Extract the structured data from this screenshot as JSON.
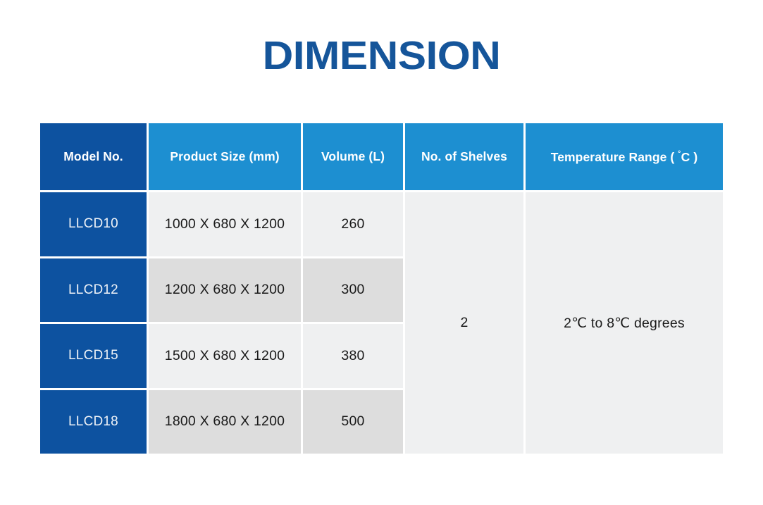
{
  "title": "DIMENSION",
  "colors": {
    "title_blue": "#15559a",
    "header_dark_blue": "#0d52a0",
    "header_light_blue": "#1d8fd1",
    "row_light": "#eff0f1",
    "row_dark": "#dddddd",
    "page_background": "#ffffff",
    "header_text": "#ffffff",
    "model_text": "#eef2f7",
    "body_text": "#1a1a1a"
  },
  "table": {
    "headers": {
      "model": "Model No.",
      "size": "Product Size (mm)",
      "volume": "Volume (L)",
      "shelves": "No. of Shelves",
      "temperature_prefix": "Temperature Range ( ",
      "temperature_degree": "˚",
      "temperature_suffix": "C )",
      "temperature_full": "Temperature Range ( ˚C )"
    },
    "rows": [
      {
        "model": "LLCD10",
        "size": "1000 X 680 X 1200",
        "volume": "260"
      },
      {
        "model": "LLCD12",
        "size": "1200 X 680 X 1200",
        "volume": "300"
      },
      {
        "model": "LLCD15",
        "size": "1500 X 680 X 1200",
        "volume": "380"
      },
      {
        "model": "LLCD18",
        "size": "1800 X 680 X 1200",
        "volume": "500"
      }
    ],
    "merged": {
      "shelves": "2",
      "temperature": "2℃ to 8℃ degrees"
    }
  }
}
